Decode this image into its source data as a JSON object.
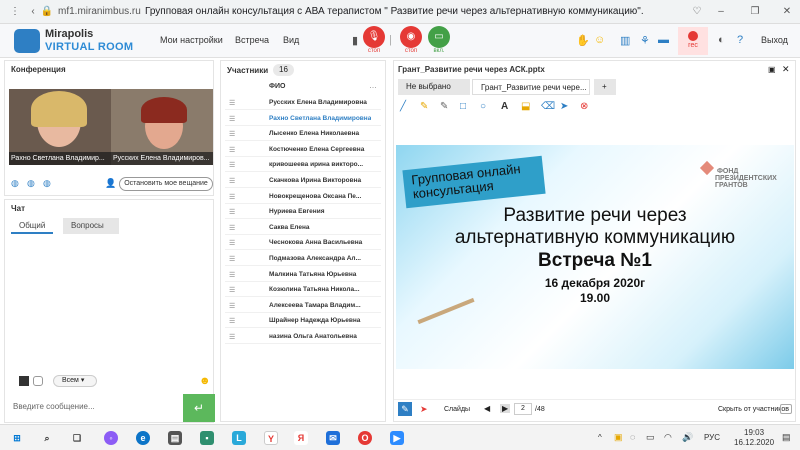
{
  "browser": {
    "url": "mf1.miranimbus.ru",
    "title": "Групповая онлайн консультация с АВА теpапистом \" Развитие речи через альтернативную коммуникацию\"."
  },
  "header": {
    "logo_line1": "Mirapolis",
    "logo_line2": "VIRTUAL ROOM",
    "menu": [
      "Мои настройки",
      "Встреча",
      "Вид"
    ],
    "rec_labels": [
      "стоп",
      "стоп",
      "вкл."
    ],
    "rec_badge": "rec",
    "exit": "Выход"
  },
  "conference": {
    "title": "Конференция",
    "videos": [
      "Рахно Светлана  Владимир...",
      "Русских Елена Владимиров..."
    ],
    "stop_button": "Остановить мое вещание"
  },
  "chat": {
    "title": "Чат",
    "tabs": [
      "Общий",
      "Вопросы"
    ],
    "recipient": "Всем",
    "input_placeholder": "Введите сообщение..."
  },
  "participants": {
    "title": "Участники",
    "count": "16",
    "column": "ФИО",
    "names": [
      "Русских Елена Владимировна",
      "Рахно Светлана  Владимировна",
      "Лысенко Елена  Николаевна",
      "Костюченко Елена Сергеевна",
      "кривошеева ирина викторо...",
      "Скачкова  Ирина Викторовна",
      "Новокрещенова  Оксана Пе...",
      "Нуриева Евгения",
      "Саква  Елена",
      "Чеснокова  Анна  Васильевна",
      "Подмазова  Александра Ал...",
      "Малкина Татьяна  Юрьевна",
      "Козюлина  Татьяна Никола...",
      "Алексеева  Тамара  Владим...",
      "Шрайнер Надежда Юрьевна",
      "назина  Ольга Анатольевна"
    ]
  },
  "presentation": {
    "title": "Грант_Развитие речи через АСК.pptx",
    "tabs": [
      "Не выбрано",
      "Грант_Развитие речи чере...",
      "+"
    ],
    "slide": {
      "banner": "Групповая онлайн консультация",
      "fond": [
        "ФОНД",
        "ПРЕЗИДЕНТСКИХ",
        "ГРАНТОВ"
      ],
      "heading1": "Развитие речи через",
      "heading2": "альтернативную коммуникацию",
      "heading3": "Встреча №1",
      "date": "16 декабря 2020г",
      "time": "19.00"
    },
    "slides_label": "Слайды",
    "page": "2",
    "total": "/48",
    "hidden_label": "Скрыть от участников"
  },
  "taskbar": {
    "time": "19:03",
    "date": "16.12.2020",
    "lang": "РУС"
  }
}
